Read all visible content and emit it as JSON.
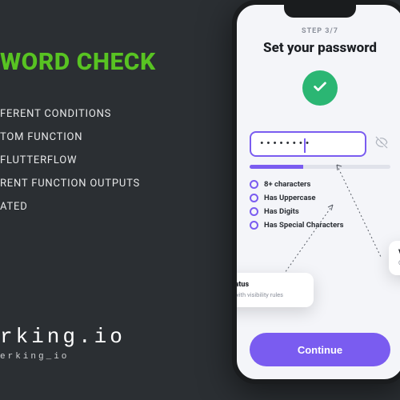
{
  "left": {
    "title": "WORD CHECK",
    "bullets": [
      "FERENT CONDITIONS",
      "TOM FUNCTION",
      "FLUTTERFLOW",
      "RENT FUNCTION OUTPUTS",
      "ATED"
    ],
    "brand_name": "rking.io",
    "brand_handle": "erking_io"
  },
  "phone": {
    "step_label": "STEP 3/7",
    "heading": "Set your password",
    "password_mask": "••••••••",
    "strength_percent": 38,
    "checks": [
      "8+ characters",
      "Has Uppercase",
      "Has Digits",
      "Has Special Characters"
    ],
    "continue_label": "Continue",
    "callout_left": {
      "title": "Step Status",
      "sub": "Widgets with visibility rules"
    },
    "callout_right": {
      "title": "V",
      "sub": "C"
    }
  }
}
